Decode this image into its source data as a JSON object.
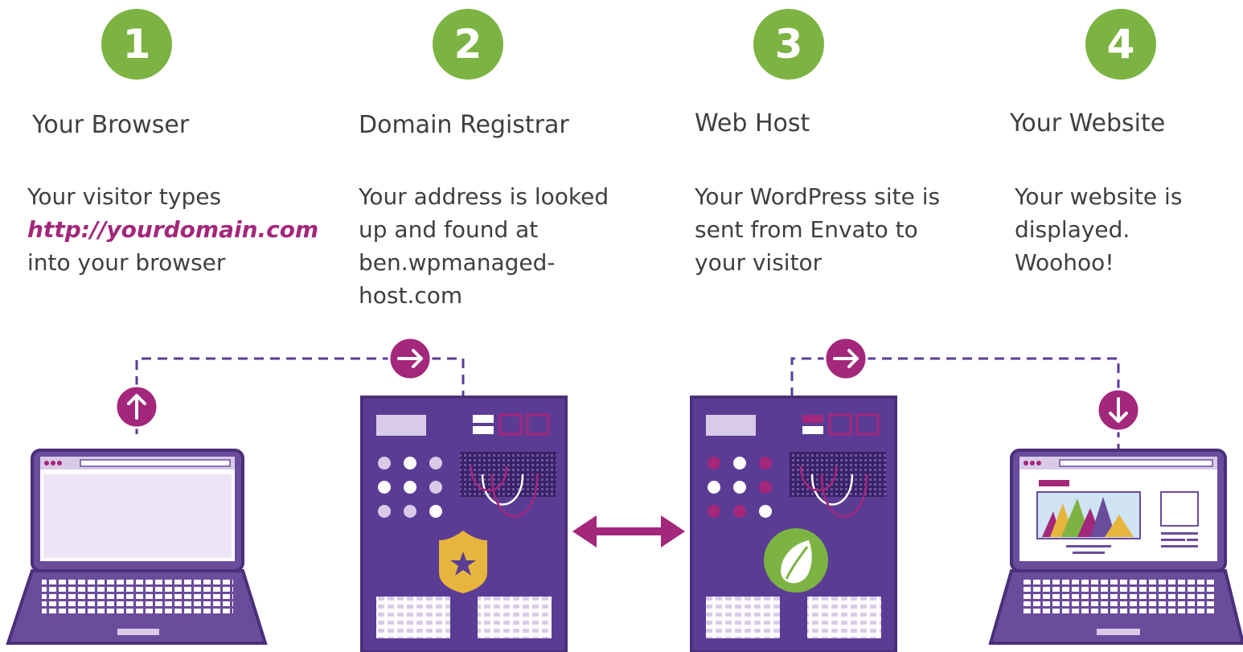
{
  "steps": [
    {
      "number": "1",
      "title": "Your Browser",
      "desc_line1": "Your visitor types",
      "desc_link": "http://yourdomain.com",
      "desc_line3": "into your browser"
    },
    {
      "number": "2",
      "title": "Domain Registrar",
      "desc": "Your address is looked up and found at ben.wpmanaged-host.com"
    },
    {
      "number": "3",
      "title": "Web Host",
      "desc": "Your WordPress site is sent from Envato to your visitor"
    },
    {
      "number": "4",
      "title": "Your Website",
      "desc": "Your website is displayed. Woohoo!"
    }
  ],
  "colors": {
    "step_badge": "#7cb342",
    "purple": "#6a4c9c",
    "purple_dark": "#4a2f7a",
    "magenta": "#a3277b",
    "lavender": "#d9cbe8",
    "gold": "#e7b53d"
  },
  "icons": [
    "up-arrow-icon",
    "right-arrow-icon",
    "down-arrow-icon",
    "double-arrow-icon",
    "shield-star-icon",
    "envato-leaf-icon"
  ]
}
